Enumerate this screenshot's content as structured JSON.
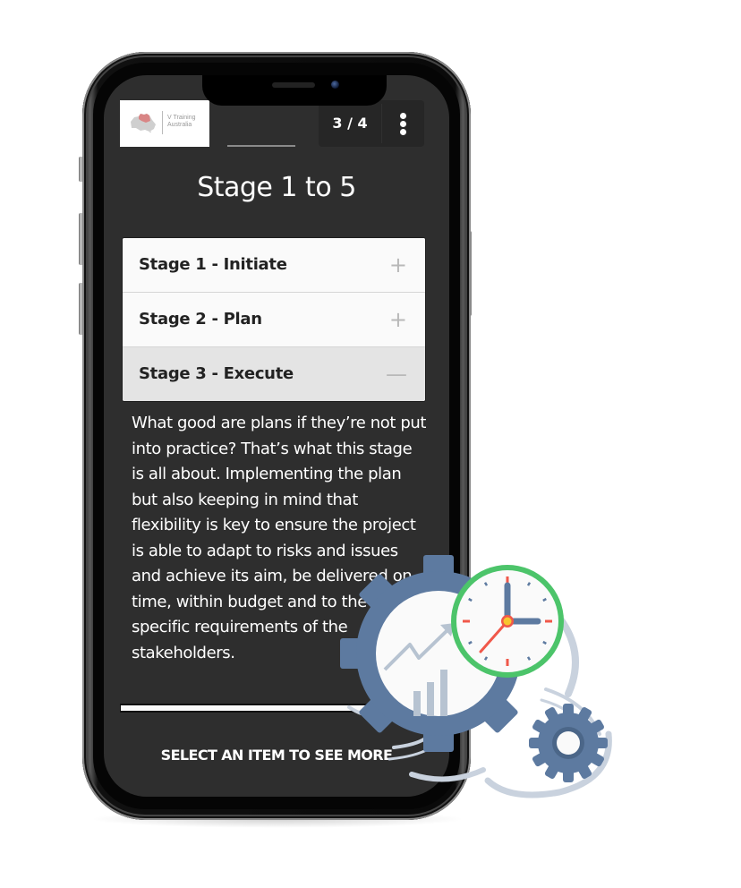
{
  "header": {
    "logo_text": "V Training Australia",
    "pager": "3 / 4",
    "menu_icon": "more-vertical-icon"
  },
  "page": {
    "title": "Stage 1 to 5"
  },
  "accordion": {
    "items": [
      {
        "label": "Stage 1 - Initiate",
        "icon": "+",
        "expanded": false
      },
      {
        "label": "Stage 2 - Plan",
        "icon": "+",
        "expanded": false
      },
      {
        "label": "Stage 3 - Execute",
        "icon": "—",
        "expanded": true
      }
    ],
    "expanded_content": "What good are plans if they’re not put into practice? That’s what this stage is all about. Implementing the plan but also keeping in mind that flexibility is key to ensure the project is able to adapt to risks and issues and achieve its aim, be delivered on time, within budget and to the specific requirements of the stakeholders."
  },
  "progress": {
    "fraction": 0.97
  },
  "footer": {
    "hint": "SELECT AN ITEM TO SEE MORE"
  },
  "colors": {
    "screen_bg": "#2e2e2e",
    "gear_blue": "#5d7aa0",
    "clock_ring": "#4cc46a",
    "clock_accent": "#f0584a",
    "clock_center": "#f7c62f"
  }
}
